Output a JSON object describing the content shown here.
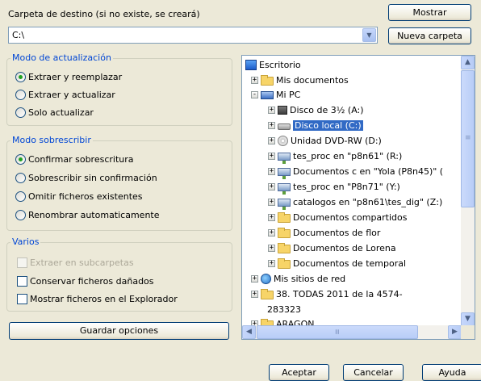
{
  "destination": {
    "label": "Carpeta de destino (si no existe, se creará)",
    "show_button": "Mostrar",
    "path_value": "C:\\",
    "new_folder_button": "Nueva carpeta"
  },
  "update_mode": {
    "title": "Modo de actualización",
    "options": [
      "Extraer y reemplazar",
      "Extraer y actualizar",
      "Solo actualizar"
    ],
    "selected": 0
  },
  "overwrite_mode": {
    "title": "Modo sobrescribir",
    "options": [
      "Confirmar sobrescritura",
      "Sobrescribir sin confirmación",
      "Omitir ficheros existentes",
      "Renombrar automaticamente"
    ],
    "selected": 0
  },
  "misc": {
    "title": "Varios",
    "options": [
      {
        "label": "Extraer en subcarpetas",
        "checked": false,
        "disabled": true
      },
      {
        "label": "Conservar ficheros dañados",
        "checked": false,
        "disabled": false
      },
      {
        "label": "Mostrar ficheros en el Explorador",
        "checked": false,
        "disabled": false
      }
    ]
  },
  "save_options_button": "Guardar opciones",
  "tree": {
    "nodes": [
      {
        "label": "Escritorio",
        "icon": "desktop-icon",
        "expander": ""
      },
      {
        "label": "Mis documentos",
        "icon": "folder-icon",
        "expander": "+"
      },
      {
        "label": "Mi PC",
        "icon": "computer-icon",
        "expander": "-"
      },
      {
        "label": "Disco de 3½ (A:)",
        "icon": "floppy-icon",
        "expander": "+"
      },
      {
        "label": "Disco local (C:)",
        "icon": "drive-icon",
        "expander": "+",
        "selected": true
      },
      {
        "label": "Unidad DVD-RW (D:)",
        "icon": "cd-icon",
        "expander": "+"
      },
      {
        "label": "tes_proc en \"p8n61\" (R:)",
        "icon": "network-drive-icon",
        "expander": "+"
      },
      {
        "label": "Documentos c en \"Yola (P8n45)\" (",
        "icon": "network-drive-icon",
        "expander": "+"
      },
      {
        "label": "tes_proc en \"P8n71\" (Y:)",
        "icon": "network-drive-icon",
        "expander": "+"
      },
      {
        "label": "catalogos en \"p8n61\\tes_dig\" (Z:)",
        "icon": "network-drive-icon",
        "expander": "+"
      },
      {
        "label": "Documentos compartidos",
        "icon": "folder-icon",
        "expander": "+"
      },
      {
        "label": "Documentos de flor",
        "icon": "folder-icon",
        "expander": "+"
      },
      {
        "label": "Documentos de Lorena",
        "icon": "folder-icon",
        "expander": "+"
      },
      {
        "label": "Documentos de temporal",
        "icon": "folder-icon",
        "expander": "+"
      },
      {
        "label": "Mis sitios de red",
        "icon": "network-places-icon",
        "expander": "+"
      },
      {
        "label": "38. TODAS 2011 de la 4574-",
        "icon": "folder-icon",
        "expander": "+"
      },
      {
        "label": "283323",
        "icon": "",
        "expander": ""
      },
      {
        "label": "ARAGON",
        "icon": "folder-icon",
        "expander": "+"
      }
    ]
  },
  "footer": {
    "accept": "Aceptar",
    "cancel": "Cancelar",
    "help": "Ayuda"
  },
  "scroll_glyphs": {
    "up": "▲",
    "down": "▼",
    "left": "◀",
    "right": "▶",
    "grip": "≡",
    "dropdown": "▼"
  }
}
